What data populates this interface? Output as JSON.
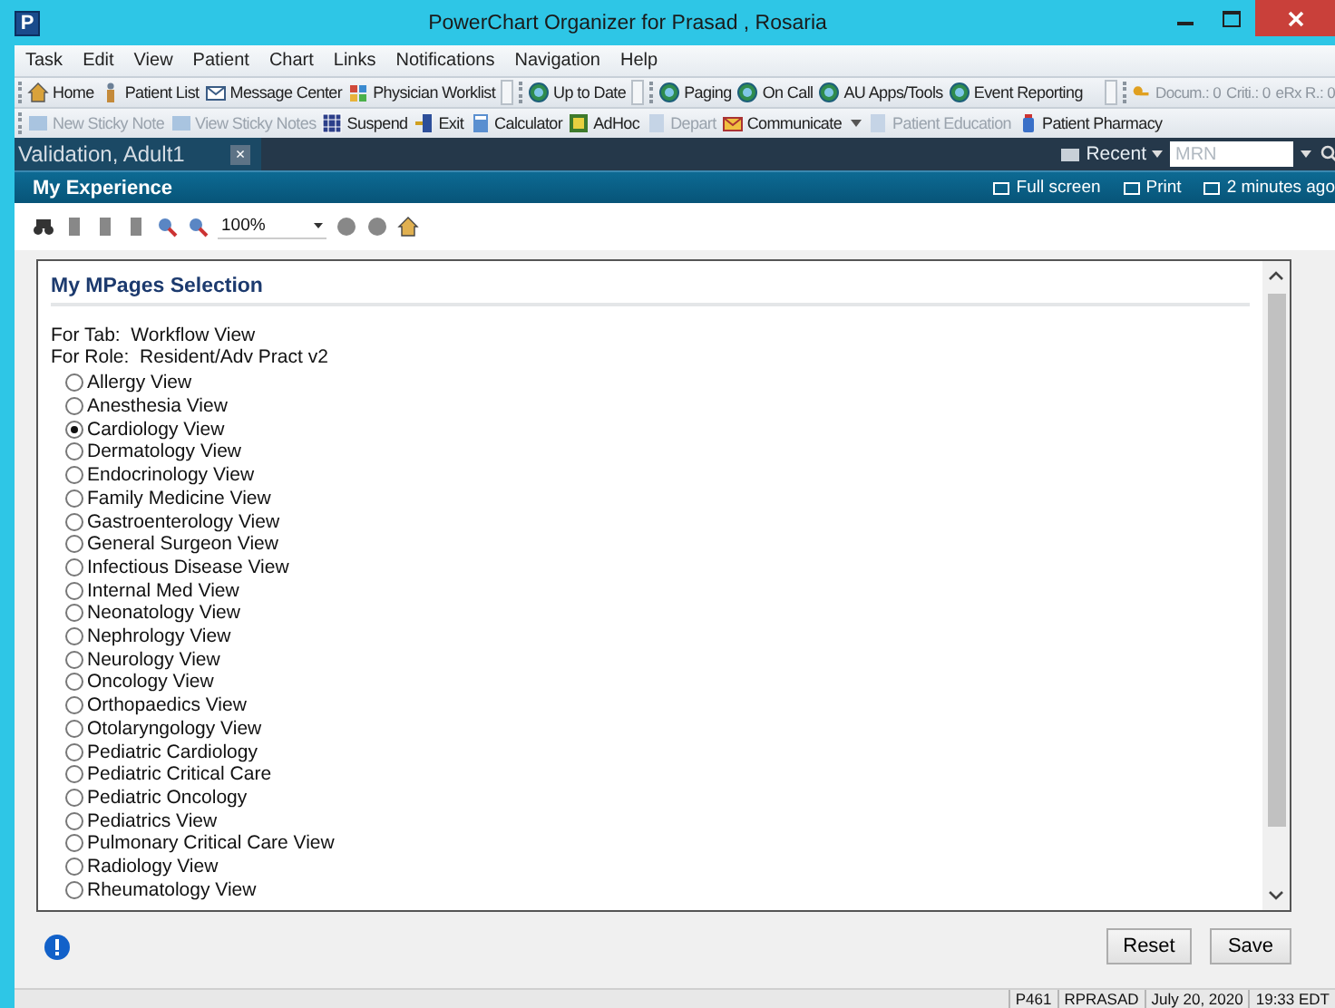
{
  "window": {
    "title": "PowerChart Organizer for Prasad , Rosaria",
    "app_letter": "P"
  },
  "menu": [
    "Task",
    "Edit",
    "View",
    "Patient",
    "Chart",
    "Links",
    "Notifications",
    "Navigation",
    "Help"
  ],
  "toolbar_1": [
    {
      "label": "Home",
      "disabled": false
    },
    {
      "label": "Patient List",
      "disabled": false
    },
    {
      "label": "Message Center",
      "disabled": false
    },
    {
      "label": "Physician Worklist",
      "disabled": false
    },
    {
      "label": "Up to Date",
      "disabled": false
    },
    {
      "label": "Paging",
      "disabled": false
    },
    {
      "label": "On Call",
      "disabled": false
    },
    {
      "label": "AU Apps/Tools",
      "disabled": false
    },
    {
      "label": "Event Reporting",
      "disabled": false
    }
  ],
  "counters": [
    "Docum.: 0",
    "Criti.: 0",
    "eRx R.: 0"
  ],
  "toolbar_2": [
    {
      "label": "New Sticky Note",
      "disabled": true
    },
    {
      "label": "View Sticky Notes",
      "disabled": true
    },
    {
      "label": "Suspend",
      "disabled": false
    },
    {
      "label": "Exit",
      "disabled": false
    },
    {
      "label": "Calculator",
      "disabled": false
    },
    {
      "label": "AdHoc",
      "disabled": false
    },
    {
      "label": "Depart",
      "disabled": true
    },
    {
      "label": "Communicate",
      "disabled": false,
      "dropdown": true
    },
    {
      "label": "Patient Education",
      "disabled": true
    },
    {
      "label": "Patient Pharmacy",
      "disabled": false
    }
  ],
  "patient_tab": {
    "label": "Validation, Adult1",
    "close": "×"
  },
  "recent": "Recent",
  "search": {
    "placeholder": "MRN"
  },
  "page_bar": {
    "title": "My Experience",
    "actions": [
      "Full screen",
      "Print",
      "2 minutes ago"
    ]
  },
  "zoom": "100%",
  "dialog": {
    "title": "My MPages Selection",
    "for_tab": {
      "label": "For Tab:",
      "value": "Workflow View"
    },
    "for_role": {
      "label": "For Role:",
      "value": "Resident/Adv Pract v2"
    },
    "options": [
      {
        "label": "Allergy View",
        "selected": false
      },
      {
        "label": "Anesthesia View",
        "selected": false
      },
      {
        "label": "Cardiology View",
        "selected": true
      },
      {
        "label": "Dermatology View",
        "selected": false
      },
      {
        "label": "Endocrinology View",
        "selected": false
      },
      {
        "label": "Family Medicine View",
        "selected": false
      },
      {
        "label": "Gastroenterology View",
        "selected": false
      },
      {
        "label": "General Surgeon View",
        "selected": false
      },
      {
        "label": "Infectious Disease View",
        "selected": false
      },
      {
        "label": "Internal Med View",
        "selected": false
      },
      {
        "label": "Neonatology View",
        "selected": false
      },
      {
        "label": "Nephrology View",
        "selected": false
      },
      {
        "label": "Neurology View",
        "selected": false
      },
      {
        "label": "Oncology View",
        "selected": false
      },
      {
        "label": "Orthopaedics View",
        "selected": false
      },
      {
        "label": "Otolaryngology View",
        "selected": false
      },
      {
        "label": "Pediatric Cardiology",
        "selected": false
      },
      {
        "label": "Pediatric Critical Care",
        "selected": false
      },
      {
        "label": "Pediatric Oncology",
        "selected": false
      },
      {
        "label": "Pediatrics View",
        "selected": false
      },
      {
        "label": "Pulmonary Critical Care View",
        "selected": false
      },
      {
        "label": "Radiology View",
        "selected": false
      },
      {
        "label": "Rheumatology View",
        "selected": false
      }
    ]
  },
  "buttons": [
    "Reset",
    "Save"
  ],
  "status_bar": [
    "P461",
    "RPRASAD",
    "July 20, 2020",
    "19:33 EDT"
  ]
}
